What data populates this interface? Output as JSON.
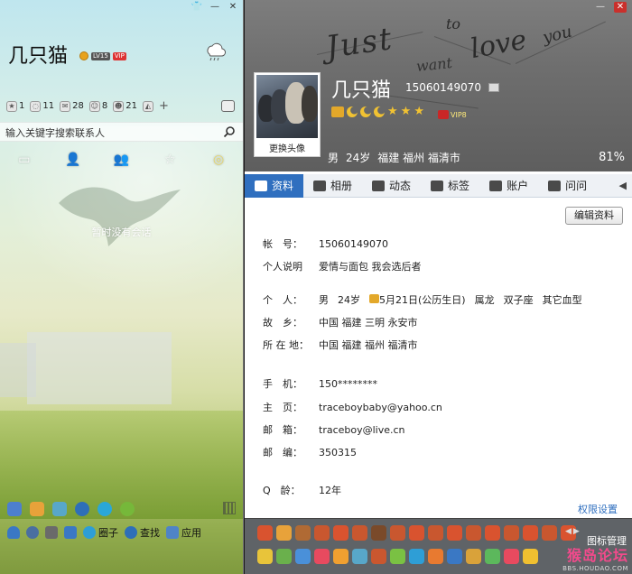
{
  "left_panel": {
    "nickname": "几只猫",
    "level_tag": "LV15",
    "vip_tag": "VIP",
    "stats": [
      {
        "icon": "star-icon",
        "count": "1"
      },
      {
        "icon": "chat-icon",
        "count": "11"
      },
      {
        "icon": "mail-icon",
        "count": "28"
      },
      {
        "icon": "people-icon",
        "count": "8"
      },
      {
        "icon": "smile-icon",
        "count": "21"
      }
    ],
    "search": {
      "placeholder": "输入关键字搜索联系人"
    },
    "tabs": [
      "chat-icon",
      "contact-icon",
      "group-icon",
      "star-icon",
      "recent-icon"
    ],
    "empty_message": "暂时没有会话",
    "bottom_bar2": {
      "circle_label": "圈子",
      "find_label": "查找",
      "apps_label": "应用"
    }
  },
  "right_panel": {
    "nickname": "几只猫",
    "qq_number": "15060149070",
    "change_avatar_label": "更换头像",
    "vip_label": "VIP8",
    "basic": {
      "gender": "男",
      "age": "24岁",
      "location": "福建 福州 福清市"
    },
    "completion": "81%",
    "tabs": [
      {
        "label": "资料",
        "icon": "profile-icon",
        "active": true
      },
      {
        "label": "相册",
        "icon": "photo-icon",
        "active": false
      },
      {
        "label": "动态",
        "icon": "feed-icon",
        "active": false
      },
      {
        "label": "标签",
        "icon": "tag-icon",
        "active": false
      },
      {
        "label": "账户",
        "icon": "account-icon",
        "active": false
      },
      {
        "label": "问问",
        "icon": "question-icon",
        "active": false
      }
    ],
    "edit_button": "编辑资料",
    "info": {
      "account": {
        "label": "帐　号：",
        "value": "15060149070"
      },
      "signature": {
        "label": "个人说明",
        "value": "爱情与面包 我会选后者"
      },
      "personal": {
        "label": "个　人：",
        "gender": "男",
        "age": "24岁",
        "birthday": "5月21日(公历生日)",
        "zodiac": "属龙",
        "constellation": "双子座",
        "blood": "其它血型"
      },
      "hometown": {
        "label": "故　乡：",
        "value": "中国 福建 三明 永安市"
      },
      "residence": {
        "label": "所 在 地：",
        "value": "中国 福建 福州 福清市"
      },
      "mobile": {
        "label": "手　机：",
        "value": "150********"
      },
      "homepage": {
        "label": "主　页：",
        "value": "traceboybaby@yahoo.cn"
      },
      "email": {
        "label": "邮　箱：",
        "value": "traceboy@live.cn"
      },
      "zip": {
        "label": "邮　编：",
        "value": "350315"
      },
      "qage": {
        "label": "Q　龄：",
        "value": "12年"
      }
    },
    "permission_link": "权限设置",
    "emoji_manage": "图标管理",
    "watermark": {
      "cn": "猴岛论坛",
      "url": "BBS.HOUDAO.COM"
    }
  },
  "colors": {
    "tab_active": "#2f6fbf",
    "header_bg": "#6e6e6e",
    "emoji_bar": "#5f6367"
  }
}
